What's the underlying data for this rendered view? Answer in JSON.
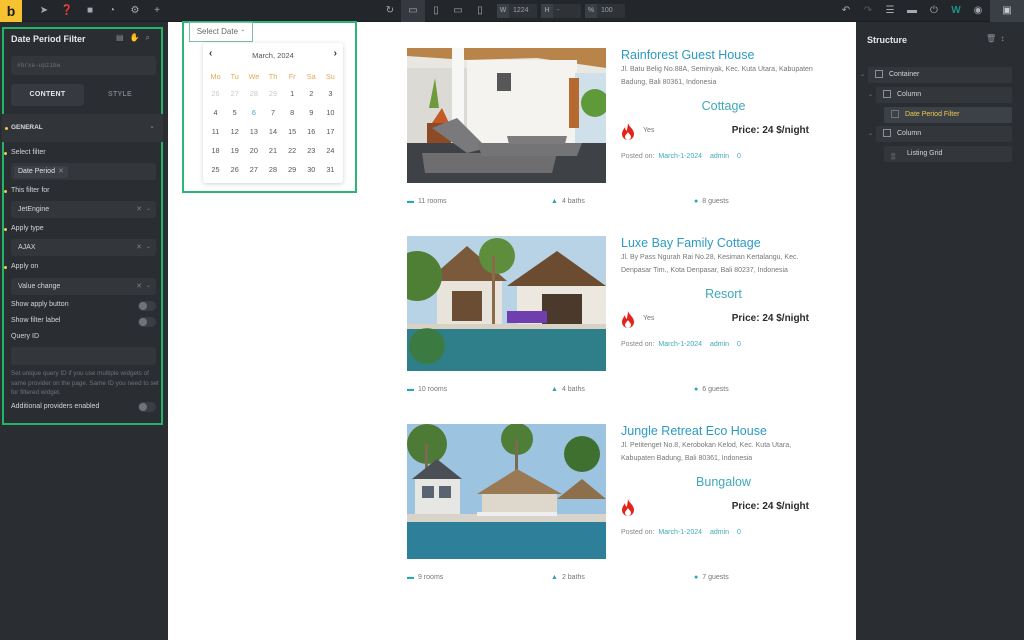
{
  "topbar": {
    "logo": "b",
    "left_icons": [
      "pointer-icon",
      "help-icon",
      "pages-icon",
      "history-icon",
      "settings-icon",
      "add-icon"
    ],
    "device_icons": [
      "desktop-icon",
      "tablet-portrait-icon",
      "tablet-landscape-icon",
      "mobile-icon"
    ],
    "width_label": "W",
    "width_value": "1224",
    "height_label": "H",
    "height_value": "-",
    "zoom_label": "%",
    "zoom_value": "100",
    "right_icons": [
      "undo-icon",
      "redo-icon",
      "menu-icon",
      "folder-icon",
      "power-icon",
      "wordpress-icon",
      "preview-icon",
      "save-icon"
    ]
  },
  "left_panel": {
    "title": "Date Period Filter",
    "element_id": "#brxe-upzibw",
    "tabs": [
      {
        "label": "CONTENT",
        "active": true
      },
      {
        "label": "STYLE",
        "active": false
      }
    ],
    "section": "GENERAL",
    "fields": {
      "select_filter": {
        "label": "Select filter",
        "chip": "Date Period"
      },
      "this_filter_for": {
        "label": "This filter for",
        "value": "JetEngine"
      },
      "apply_type": {
        "label": "Apply type",
        "value": "AJAX"
      },
      "apply_on": {
        "label": "Apply on",
        "value": "Value change"
      },
      "show_apply_button": {
        "label": "Show apply button",
        "on": false
      },
      "show_filter_label": {
        "label": "Show filter label",
        "on": false
      },
      "query_id": {
        "label": "Query ID",
        "value": "",
        "help": "Set unique query ID if you use multiple widgets of same provider on the page. Same ID you need to set for filtered widget."
      },
      "additional_providers": {
        "label": "Additional providers enabled",
        "on": false
      }
    }
  },
  "calendar": {
    "button_label": "Select Date",
    "month_label": "March, 2024",
    "weekdays": [
      "Mo",
      "Tu",
      "We",
      "Th",
      "Fr",
      "Sa",
      "Su"
    ],
    "prev_month_days": [
      "26",
      "27",
      "28",
      "29"
    ],
    "days": [
      "1",
      "2",
      "3",
      "4",
      "5",
      "6",
      "7",
      "8",
      "9",
      "10",
      "11",
      "12",
      "13",
      "14",
      "15",
      "16",
      "17",
      "18",
      "19",
      "20",
      "21",
      "22",
      "23",
      "24",
      "25",
      "26",
      "27",
      "28",
      "29",
      "30",
      "31"
    ],
    "today": "6"
  },
  "listings": [
    {
      "title": "Rainforest Guest House",
      "address": "Jl. Batu Belig No.88A, Seminyak, Kec. Kuta Utara, Kabupaten Badung, Bali 80361, Indonesia",
      "type": "Cottage",
      "hot": "Yes",
      "price": "Price: 24 $/night",
      "posted_label": "Posted on:",
      "posted_date": "March-1-2024",
      "author": "admin",
      "comments": "0",
      "rooms": "11 rooms",
      "baths": "4 baths",
      "guests": "8 guests"
    },
    {
      "title": "Luxe Bay Family Cottage",
      "address": "Jl. By Pass Ngurah Rai No.28, Kesiman Kertalangu, Kec. Denpasar Tim., Kota Denpasar, Bali 80237, Indonesia",
      "type": "Resort",
      "hot": "Yes",
      "price": "Price: 24 $/night",
      "posted_label": "Posted on:",
      "posted_date": "March-1-2024",
      "author": "admin",
      "comments": "0",
      "rooms": "10 rooms",
      "baths": "4 baths",
      "guests": "6 guests"
    },
    {
      "title": "Jungle Retreat Eco House",
      "address": "Jl. Petitenget No.8, Kerobokan Kelod, Kec. Kuta Utara, Kabupaten Badung, Bali 80361, Indonesia",
      "type": "Bungalow",
      "hot": "",
      "price": "Price: 24 $/night",
      "posted_label": "Posted on:",
      "posted_date": "March-1-2024",
      "author": "admin",
      "comments": "0",
      "rooms": "9 rooms",
      "baths": "2 baths",
      "guests": "7 guests"
    }
  ],
  "structure": {
    "title": "Structure",
    "nodes": [
      {
        "label": "Container",
        "level": 0
      },
      {
        "label": "Column",
        "level": 1
      },
      {
        "label": "Date Period Filter",
        "level": 2,
        "selected": true
      },
      {
        "label": "Column",
        "level": 1
      },
      {
        "label": "Listing Grid",
        "level": 2
      }
    ]
  },
  "colors": {
    "accent_green": "#22b467",
    "link_blue": "#2c9ac4",
    "teal": "#3fa9b7",
    "highlight_yellow": "#f2c94c",
    "fire_red": "#e3241b"
  }
}
